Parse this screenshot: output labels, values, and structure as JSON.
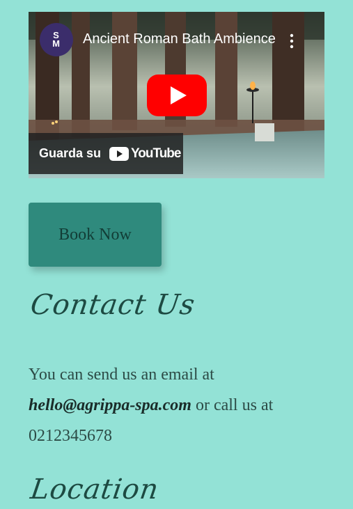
{
  "video": {
    "title": "Ancient Roman Bath Ambience",
    "channel_avatar_text": "S\nM",
    "watch_on_label": "Guarda su",
    "youtube_wordmark": "YouTube",
    "icons": {
      "menu": "kebab-menu-icon",
      "play": "play-icon",
      "youtube": "youtube-logo-icon"
    }
  },
  "book_button": {
    "label": "Book Now"
  },
  "contact": {
    "heading": "Contact Us",
    "intro": "You can send us an email at",
    "email": "hello@agrippa-spa.com",
    "connector": "or call us at",
    "phone": "0212345678"
  },
  "location": {
    "heading": "Location"
  },
  "colors": {
    "page_background": "#93e2d6",
    "button_background": "#2f8a7d",
    "heading_text": "#1d4a42",
    "youtube_red": "#ff0000"
  }
}
